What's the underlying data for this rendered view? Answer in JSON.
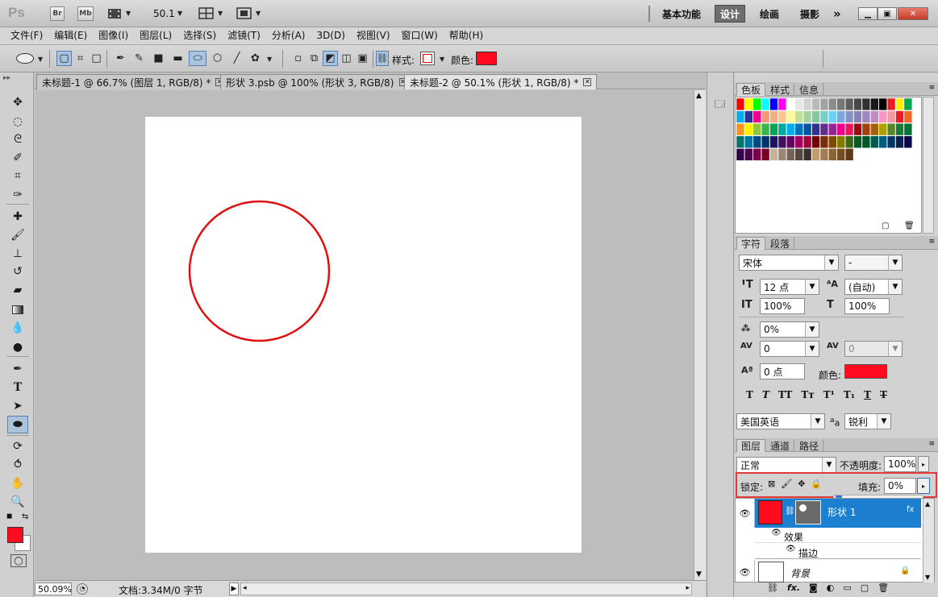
{
  "app": {
    "logo": "Ps",
    "bridge_label": "Br",
    "minibridge_label": "Mb",
    "zoom_value": "50.1",
    "workspaces": [
      "基本功能",
      "设计",
      "绘画",
      "摄影"
    ],
    "more_label": "»"
  },
  "menu": [
    "文件(F)",
    "编辑(E)",
    "图像(I)",
    "图层(L)",
    "选择(S)",
    "滤镜(T)",
    "分析(A)",
    "3D(D)",
    "视图(V)",
    "窗口(W)",
    "帮助(H)"
  ],
  "options": {
    "style_label": "样式:",
    "color_label": "颜色:",
    "color": "#ff0a1e"
  },
  "tabs": [
    {
      "label": "未标题-1 @ 66.7% (图层 1, RGB/8) *"
    },
    {
      "label": "形状 3.psb @ 100% (形状 3, RGB/8)"
    },
    {
      "label": "未标题-2 @ 50.1% (形状 1, RGB/8) *"
    }
  ],
  "status": {
    "zoom": "50.09%",
    "doc_info": "文档:3.34M/0 字节"
  },
  "swatches_panel": {
    "tabs": [
      "色板",
      "样式",
      "信息"
    ]
  },
  "char_panel": {
    "tabs": [
      "字符",
      "段落"
    ],
    "font_family": "宋体",
    "font_style": "-",
    "size": "12 点",
    "leading": "(自动)",
    "vscale": "100%",
    "hscale": "100%",
    "tsume": "0%",
    "kerning": "0",
    "tracking": "0",
    "baseline": "0 点",
    "color_label": "颜色:",
    "color": "#ff0a1e",
    "language": "美国英语",
    "aa_label": "a",
    "antialias": "锐利"
  },
  "layers_panel": {
    "tabs": [
      "图层",
      "通道",
      "路径"
    ],
    "blend_mode": "正常",
    "opacity_label": "不透明度:",
    "opacity": "100%",
    "lock_label": "锁定:",
    "fill_label": "填充:",
    "fill": "0%",
    "fill_fraction": 0,
    "layers": [
      {
        "name": "形状 1"
      },
      {
        "name": "背景"
      }
    ],
    "effects_label": "效果",
    "stroke_label": "描边",
    "highlight_color": "#e3393a",
    "selected_color": "#1d7fd0"
  }
}
